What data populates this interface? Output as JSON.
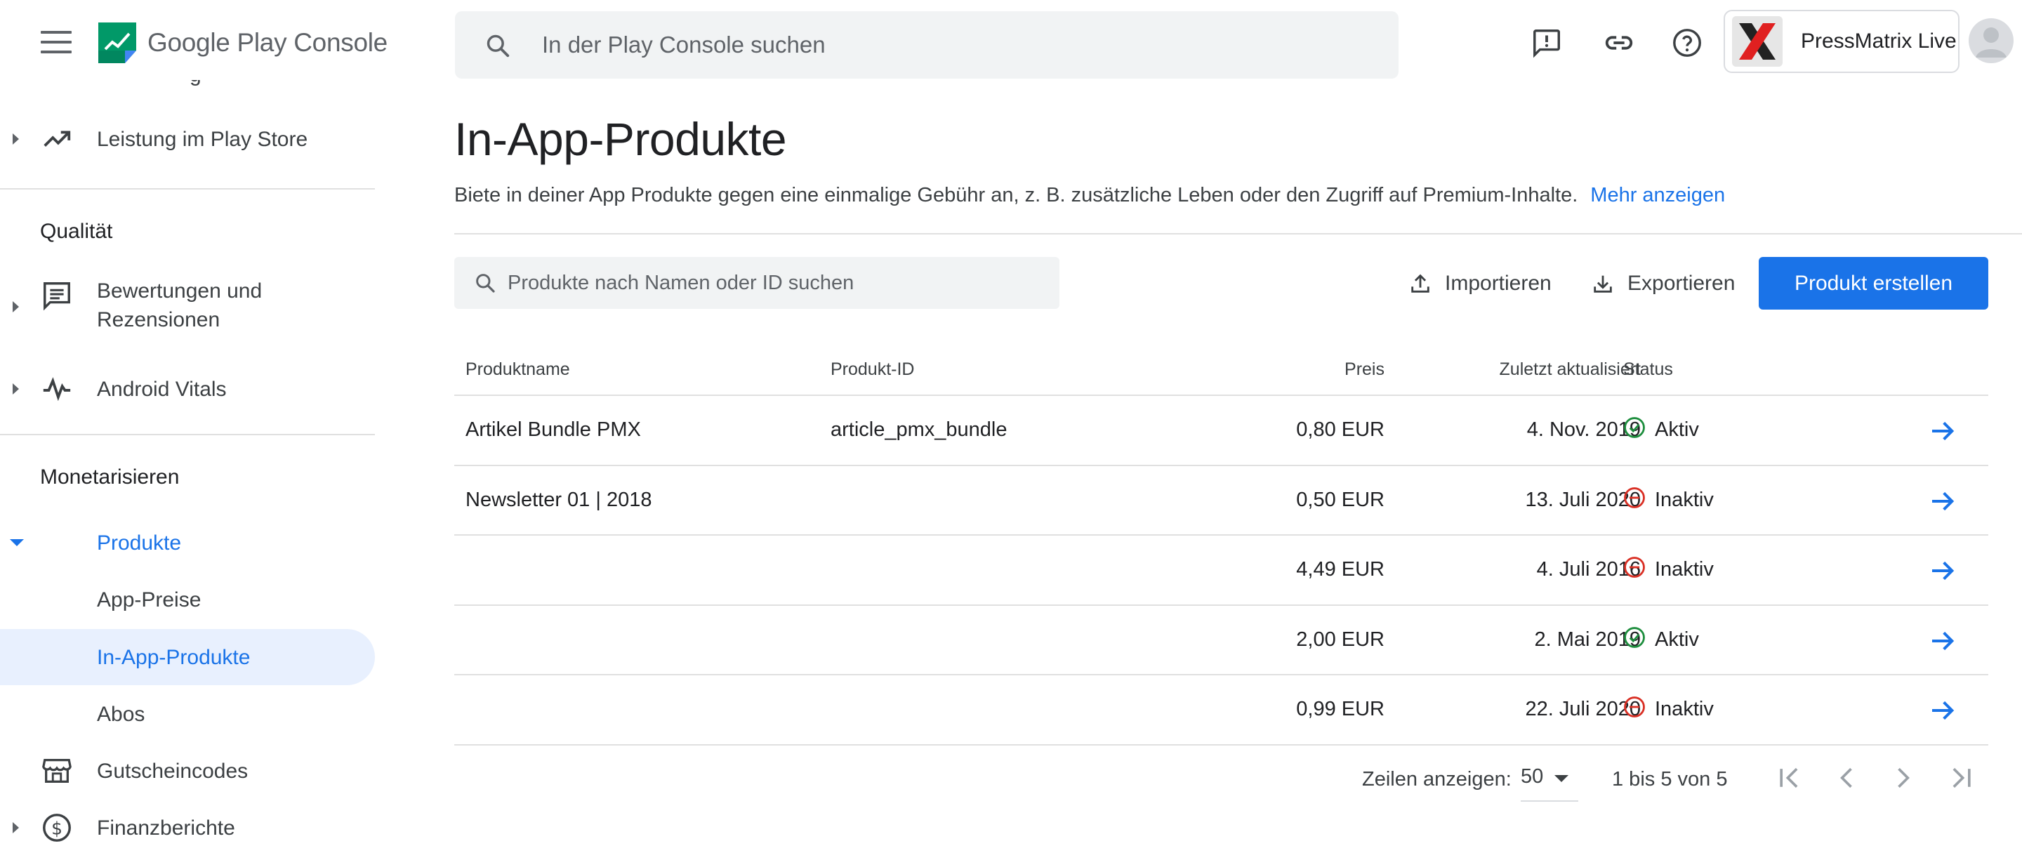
{
  "topbar": {
    "logo_google_play": "Google Play",
    "logo_console": "Console",
    "search_placeholder": "In der Play Console suchen",
    "account_name": "PressMatrix Live"
  },
  "sidebar": {
    "cut_off_text": "g",
    "items_top": [
      {
        "label": "Leistung im Play Store",
        "icon": "trending-up-icon"
      }
    ],
    "section_quality": "Qualität",
    "quality_items": [
      {
        "label_line1": "Bewertungen und",
        "label_line2": "Rezensionen",
        "icon": "review-icon"
      },
      {
        "label": "Android Vitals",
        "icon": "vitals-icon"
      }
    ],
    "section_monetize": "Monetarisieren",
    "monetize_items": [
      {
        "label": "Produkte"
      },
      {
        "label": "App-Preise"
      },
      {
        "label": "In-App-Produkte"
      },
      {
        "label": "Abos"
      },
      {
        "label": "Gutscheincodes",
        "icon": "store-icon"
      },
      {
        "label": "Finanzberichte",
        "icon": "dollar-icon"
      }
    ]
  },
  "main": {
    "title": "In-App-Produkte",
    "description": "Biete in deiner App Produkte gegen eine einmalige Gebühr an, z. B. zusätzliche Leben oder den Zugriff auf Premium-Inhalte.",
    "more_link": "Mehr anzeigen",
    "product_search_placeholder": "Produkte nach Namen oder ID suchen",
    "import_label": "Importieren",
    "export_label": "Exportieren",
    "create_label": "Produkt erstellen"
  },
  "table": {
    "headers": {
      "name": "Produktname",
      "id": "Produkt-ID",
      "price": "Preis",
      "updated": "Zuletzt aktualisiert",
      "status": "Status"
    },
    "rows": [
      {
        "name": "Artikel Bundle PMX",
        "id": "article_pmx_bundle",
        "price": "0,80 EUR",
        "updated": "4. Nov. 2019",
        "status": "Aktiv",
        "status_type": "active"
      },
      {
        "name": "Newsletter 01 | 2018",
        "id": "",
        "price": "0,50 EUR",
        "updated": "13. Juli 2020",
        "status": "Inaktiv",
        "status_type": "inactive"
      },
      {
        "name": "",
        "id": "",
        "price": "4,49 EUR",
        "updated": "4. Juli 2016",
        "status": "Inaktiv",
        "status_type": "inactive"
      },
      {
        "name": "",
        "id": "",
        "price": "2,00 EUR",
        "updated": "2. Mai 2019",
        "status": "Aktiv",
        "status_type": "active"
      },
      {
        "name": "",
        "id": "",
        "price": "0,99 EUR",
        "updated": "22. Juli 2020",
        "status": "Inaktiv",
        "status_type": "inactive"
      }
    ]
  },
  "pagination": {
    "rows_label": "Zeilen anzeigen:",
    "rows_value": "50",
    "range": "1 bis 5 von 5"
  },
  "colors": {
    "accent": "#1a73e8",
    "active_green": "#1e8e3e",
    "inactive_red": "#d93025",
    "active_nav_bg": "#e8f0fe"
  }
}
